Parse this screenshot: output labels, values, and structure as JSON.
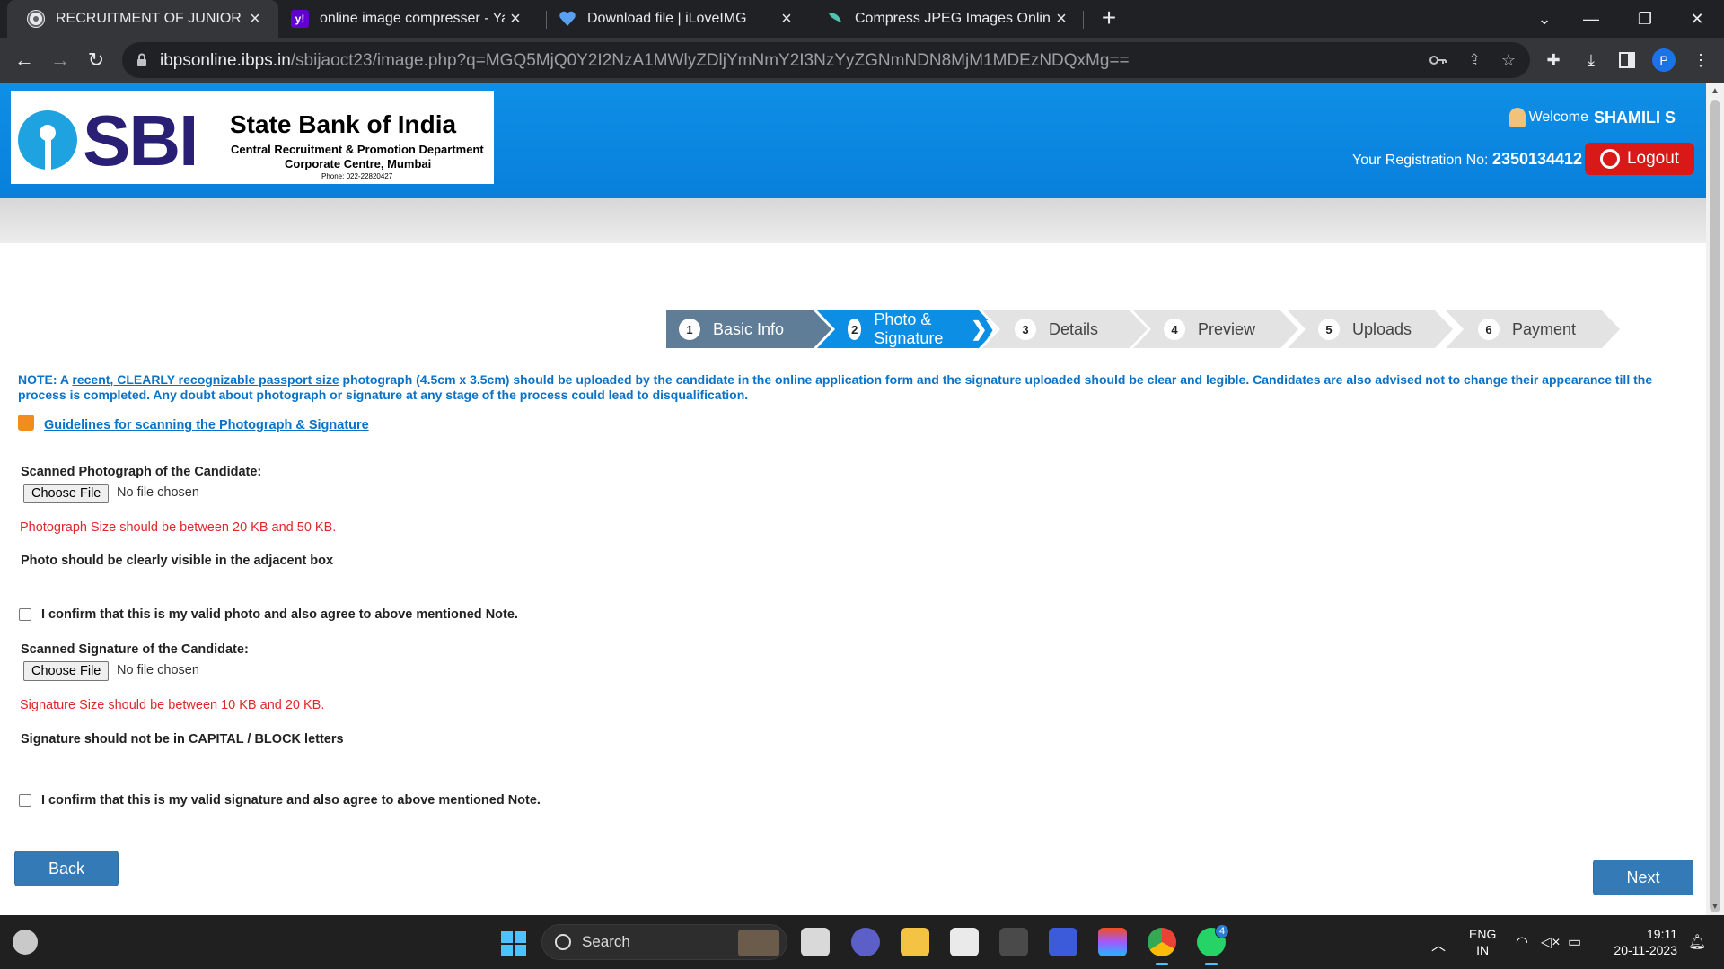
{
  "browser": {
    "tabs": [
      {
        "title": "RECRUITMENT OF JUNIOR ASSO",
        "favicon": "globe-icon",
        "active": true
      },
      {
        "title": "online image compresser - Yahoo",
        "favicon": "yahoo-icon",
        "active": false
      },
      {
        "title": "Download file | iLoveIMG",
        "favicon": "iloveimg-heart-icon",
        "active": false
      },
      {
        "title": "Compress JPEG Images Online",
        "favicon": "compress-jpeg-icon",
        "active": false
      }
    ],
    "new_tab": "+",
    "url_host": "ibpsonline.ibps.in",
    "url_path": "/sbijaoct23/image.php?q=MGQ5MjQ0Y2I2NzA1MWlyZDljYmNmY2I3NzYyZGNmNDN8MjM1MDEzNDQxMg==",
    "profile_initial": "P"
  },
  "header": {
    "logo_text": "SBI",
    "bank_name": "State Bank of India",
    "dept_line1": "Central Recruitment & Promotion Department",
    "dept_line2": "Corporate Centre, Mumbai",
    "phone": "Phone: 022-22820427",
    "welcome_label": "Welcome",
    "user_name": "SHAMILI S",
    "reg_label": "Your Registration No:",
    "reg_no": "2350134412",
    "logout_label": "Logout"
  },
  "steps": [
    {
      "num": "1",
      "label": "Basic Info",
      "state": "done"
    },
    {
      "num": "2",
      "label": "Photo & Signature",
      "state": "current"
    },
    {
      "num": "3",
      "label": "Details",
      "state": "todo"
    },
    {
      "num": "4",
      "label": "Preview",
      "state": "todo"
    },
    {
      "num": "5",
      "label": "Uploads",
      "state": "todo"
    },
    {
      "num": "6",
      "label": "Payment",
      "state": "todo"
    }
  ],
  "note": {
    "prefix": "NOTE: A ",
    "underlined": "recent, CLEARLY recognizable passport size",
    "rest": " photograph (4.5cm x 3.5cm) should be uploaded by the candidate in the online application form and the signature uploaded should be clear and legible. Candidates are also advised not to change their appearance till the process is completed. Any doubt about photograph or signature at any stage of the process could lead to disqualification."
  },
  "guidelines_link": "Guidelines for scanning the Photograph & Signature",
  "photo": {
    "label": "Scanned Photograph of the Candidate:",
    "choose_file": "Choose File",
    "no_file": "No file chosen",
    "size_note": "Photograph Size should be between 20 KB and 50 KB.",
    "visibility_note": "Photo should be clearly visible in the adjacent box",
    "confirm": "I confirm that this is my valid photo and also agree to above mentioned Note."
  },
  "signature": {
    "label": "Scanned Signature of the Candidate:",
    "choose_file": "Choose File",
    "no_file": "No file chosen",
    "size_note": "Signature Size should be between 10 KB and 20 KB.",
    "caps_note": "Signature should not be in CAPITAL / BLOCK letters",
    "confirm": "I confirm that this is my valid signature and also agree to above mentioned Note."
  },
  "buttons": {
    "back": "Back",
    "next": "Next"
  },
  "taskbar": {
    "search_placeholder": "Search",
    "lang_line1": "ENG",
    "lang_line2": "IN",
    "time": "19:11",
    "date": "20-11-2023",
    "whatsapp_badge": "4"
  },
  "colors": {
    "header_blue": "#0b8ee3",
    "step_done": "#5f7d96",
    "step_current": "#0b8ee3",
    "note_blue": "#0a72c8",
    "error_red": "#e0282b",
    "logout_red": "#d91818",
    "button_blue": "#337ab7"
  }
}
